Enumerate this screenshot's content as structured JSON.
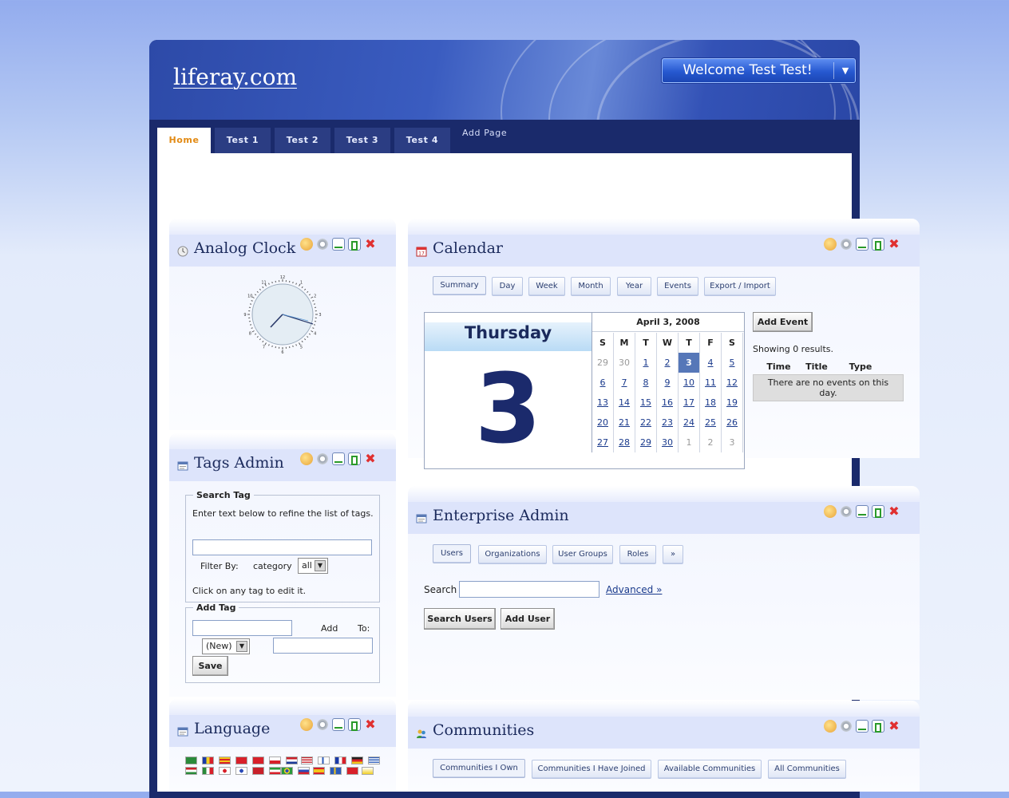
{
  "site": {
    "logo": "liferay.com",
    "welcome": "Welcome Test Test!"
  },
  "nav": {
    "tabs": [
      "Home",
      "Test 1",
      "Test 2",
      "Test 3",
      "Test 4"
    ],
    "selected": "Home",
    "add_page": "Add Page"
  },
  "clock": {
    "title": "Analog Clock",
    "numbers": [
      "12",
      "1",
      "2",
      "3",
      "4",
      "5",
      "6",
      "7",
      "8",
      "9",
      "10",
      "11"
    ]
  },
  "tags": {
    "title": "Tags Admin",
    "search_legend": "Search Tag",
    "help": "Enter text below to refine the list of tags.",
    "filter_label": "Filter By:",
    "filter_category": "category",
    "filter_value": "all",
    "click_hint": "Click on any tag to edit it.",
    "add_legend": "Add Tag",
    "add_label": "Add",
    "to_label": "To:",
    "new_option": "(New)",
    "save": "Save"
  },
  "language": {
    "title": "Language"
  },
  "calendar": {
    "title": "Calendar",
    "tabs": [
      "Summary",
      "Day",
      "Week",
      "Month",
      "Year",
      "Events",
      "Export / Import"
    ],
    "selected_tab": "Summary",
    "day_name": "Thursday",
    "day_number": "3",
    "month_title": "April 3, 2008",
    "weekdays": [
      "S",
      "M",
      "T",
      "W",
      "T",
      "F",
      "S"
    ],
    "weeks": [
      [
        "29",
        "30",
        "1",
        "2",
        "3",
        "4",
        "5"
      ],
      [
        "6",
        "7",
        "8",
        "9",
        "10",
        "11",
        "12"
      ],
      [
        "13",
        "14",
        "15",
        "16",
        "17",
        "18",
        "19"
      ],
      [
        "20",
        "21",
        "22",
        "23",
        "24",
        "25",
        "26"
      ],
      [
        "27",
        "28",
        "29",
        "30",
        "1",
        "2",
        "3"
      ]
    ],
    "add_event": "Add Event",
    "results": "Showing 0 results.",
    "columns": [
      "Time",
      "Title",
      "Type"
    ],
    "empty": "There are no events on this day."
  },
  "enterprise": {
    "title": "Enterprise Admin",
    "tabs": [
      "Users",
      "Organizations",
      "User Groups",
      "Roles",
      "»"
    ],
    "selected_tab": "Users",
    "search_label": "Search",
    "advanced": "Advanced »",
    "search_users": "Search Users",
    "add_user": "Add User"
  },
  "communities": {
    "title": "Communities",
    "tabs": [
      "Communities I Own",
      "Communities I Have Joined",
      "Available Communities",
      "All Communities"
    ],
    "selected_tab": "Communities I Own"
  },
  "colors": {
    "frame": "#1a2a6b",
    "tab_bg": "#2b3d83",
    "selected_tab_text": "#e28a14",
    "titlebar": "#dde4fb",
    "today": "#5677b8"
  }
}
